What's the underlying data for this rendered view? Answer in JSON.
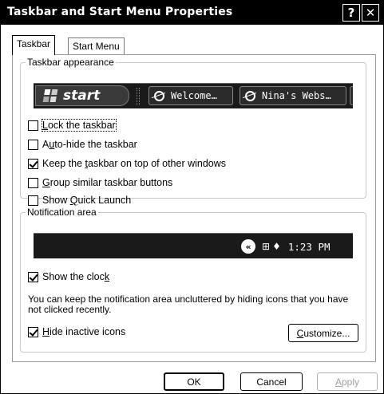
{
  "window": {
    "title": "Taskbar and Start Menu Properties",
    "help_label": "?",
    "close_label": "✕"
  },
  "tabs": [
    {
      "label": "Taskbar",
      "selected": true
    },
    {
      "label": "Start Menu",
      "selected": false
    }
  ],
  "taskbar_appearance": {
    "legend": "Taskbar appearance",
    "preview": {
      "start_label": "start",
      "task_buttons": [
        "Welcome…",
        "Nina's Webs…"
      ]
    },
    "options": [
      {
        "pre": "",
        "key": "L",
        "post": "ock the taskbar",
        "checked": false
      },
      {
        "pre": "A",
        "key": "u",
        "post": "to-hide the taskbar",
        "checked": false
      },
      {
        "pre": "Keep the ",
        "key": "t",
        "post": "askbar on top of other windows",
        "checked": true
      },
      {
        "pre": "",
        "key": "G",
        "post": "roup similar taskbar buttons",
        "checked": false
      },
      {
        "pre": "Show ",
        "key": "Q",
        "post": "uick Launch",
        "checked": false
      }
    ]
  },
  "notification_area": {
    "legend": "Notification area",
    "preview": {
      "clock": "1:23 PM",
      "chevron": "«"
    },
    "show_clock": {
      "pre": "Show the cloc",
      "key": "k",
      "post": "",
      "checked": true
    },
    "hint": "You can keep the notification area uncluttered by hiding icons that you have not clicked recently.",
    "hide_inactive": {
      "pre": "",
      "key": "H",
      "post": "ide inactive icons",
      "checked": true
    },
    "customize": {
      "key": "C",
      "post": "ustomize..."
    }
  },
  "buttons": {
    "ok": "OK",
    "cancel": "Cancel",
    "apply_key": "A",
    "apply_post": "pply"
  }
}
